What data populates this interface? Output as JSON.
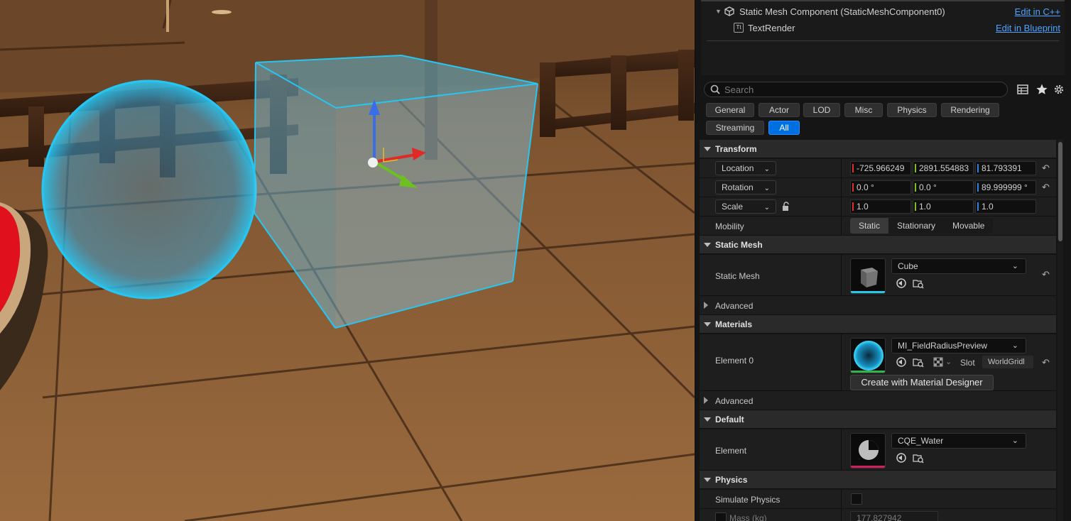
{
  "component_tree": {
    "items": [
      {
        "icon": "cube-component-icon",
        "label": "Static Mesh Component (StaticMeshComponent0)",
        "link": "Edit in C++"
      },
      {
        "icon": "text-render-icon",
        "label": "TextRender",
        "link": "Edit in Blueprint"
      }
    ]
  },
  "search": {
    "placeholder": "Search"
  },
  "filters": [
    {
      "label": "General"
    },
    {
      "label": "Actor"
    },
    {
      "label": "LOD"
    },
    {
      "label": "Misc"
    },
    {
      "label": "Physics"
    },
    {
      "label": "Rendering"
    },
    {
      "label": "Streaming"
    },
    {
      "label": "All",
      "active": true
    }
  ],
  "transform": {
    "title": "Transform",
    "location": {
      "label": "Location",
      "x": "-725.966249",
      "y": "2891.554883",
      "z": "81.793391"
    },
    "rotation": {
      "label": "Rotation",
      "x": "0.0 °",
      "y": "0.0 °",
      "z": "89.999999 °"
    },
    "scale": {
      "label": "Scale",
      "x": "1.0",
      "y": "1.0",
      "z": "1.0"
    },
    "mobility": {
      "label": "Mobility",
      "options": [
        "Static",
        "Stationary",
        "Movable"
      ],
      "selected": "Static"
    }
  },
  "static_mesh": {
    "title": "Static Mesh",
    "label": "Static Mesh",
    "asset": "Cube",
    "advanced": "Advanced",
    "thumb_bar_color": "#27c6e8"
  },
  "materials": {
    "title": "Materials",
    "element_label": "Element 0",
    "asset": "MI_FieldRadiusPreview",
    "slot_label": "Slot",
    "slot_value": "WorldGridl",
    "create_button": "Create with Material Designer",
    "advanced": "Advanced",
    "thumb_bar_color": "#35b34a"
  },
  "default": {
    "title": "Default",
    "element_label": "Element",
    "asset": "CQE_Water",
    "thumb_bar_color": "#d02060"
  },
  "physics": {
    "title": "Physics",
    "simulate_label": "Simulate Physics",
    "simulate_checked": false,
    "mass_label": "Mass (kg)",
    "mass_value": "177.827942"
  }
}
